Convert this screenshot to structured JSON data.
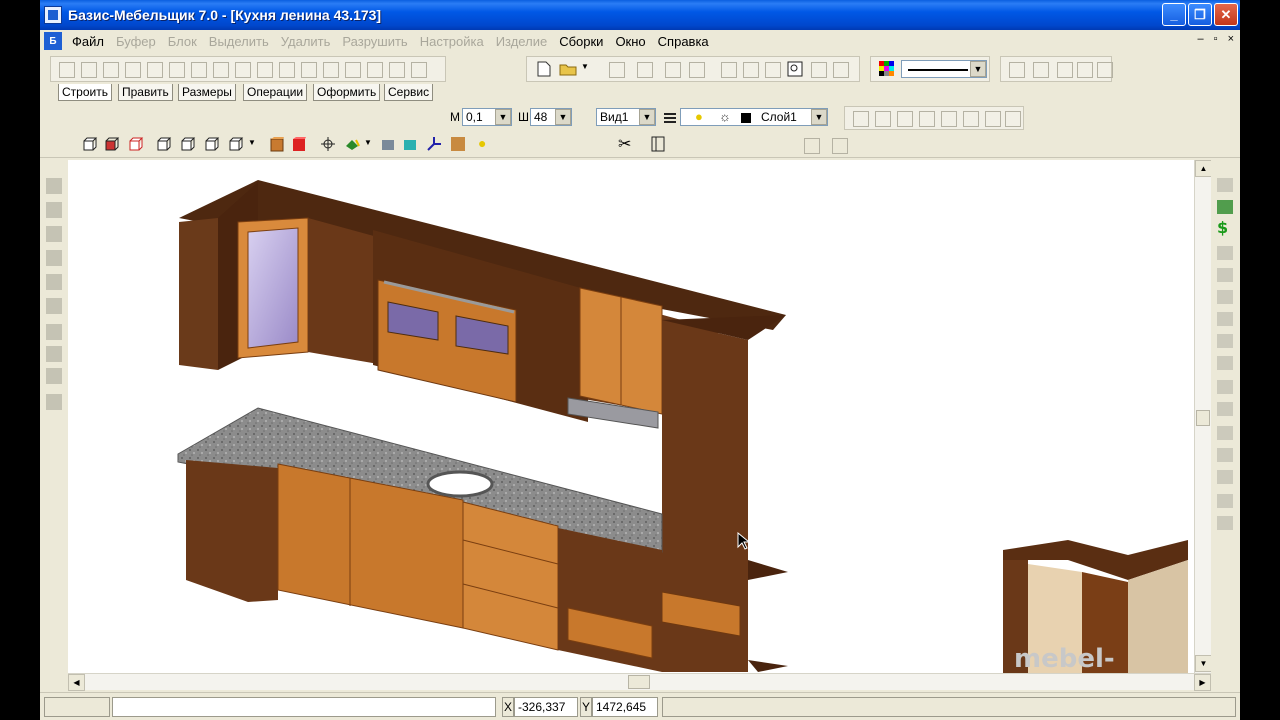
{
  "window": {
    "title": "Базис-Мебельщик 7.0 - [Кухня ленина 43.173]",
    "controls": [
      "_",
      "❐",
      "✕"
    ]
  },
  "menu": {
    "app_icon_text": "Б",
    "items": [
      {
        "label": "Файл",
        "enabled": true
      },
      {
        "label": "Буфер",
        "enabled": false
      },
      {
        "label": "Блок",
        "enabled": false
      },
      {
        "label": "Выделить",
        "enabled": false
      },
      {
        "label": "Удалить",
        "enabled": false
      },
      {
        "label": "Разрушить",
        "enabled": false
      },
      {
        "label": "Настройка",
        "enabled": false
      },
      {
        "label": "Изделие",
        "enabled": false
      },
      {
        "label": "Сборки",
        "enabled": true
      },
      {
        "label": "Окно",
        "enabled": true
      },
      {
        "label": "Справка",
        "enabled": true
      }
    ],
    "mdi_controls": [
      "–",
      "▫",
      "×"
    ]
  },
  "tabs": [
    "Строить",
    "Править",
    "Размеры",
    "Операции",
    "Оформить",
    "Сервис"
  ],
  "toolbar": {
    "scale_label": "М",
    "scale_value": "0,1",
    "step_label": "Ш",
    "step_value": "48",
    "view_value": "Вид1",
    "layer_value": "Слой1"
  },
  "status": {
    "x_label": "X",
    "x_value": "-326,337",
    "y_label": "Y",
    "y_value": "1472,645"
  },
  "watermark": "mebel-id.com",
  "colors": {
    "titlebar": "#0058e6",
    "chrome": "#ece9d8",
    "dark_wood": "#5a2e14",
    "orange_wood": "#c8792e",
    "countertop": "#8a8a8a"
  }
}
